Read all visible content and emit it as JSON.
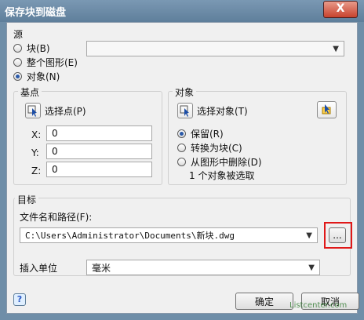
{
  "window": {
    "title": "保存块到磁盘",
    "close_label": "X"
  },
  "source": {
    "legend": "源",
    "block_label": "块(B)",
    "entire_drawing_label": "整个图形(E)",
    "objects_label": "对象(N)",
    "selected_index": 2,
    "block_select_value": ""
  },
  "basepoint": {
    "legend": "基点",
    "pick_label": "选择点(P)",
    "x_label": "X:",
    "y_label": "Y:",
    "z_label": "Z:",
    "x_value": "0",
    "y_value": "0",
    "z_value": "0"
  },
  "objects": {
    "legend": "对象",
    "select_label": "选择对象(T)",
    "retain_label": "保留(R)",
    "convert_label": "转换为块(C)",
    "delete_label": "从图形中删除(D)",
    "selected_count_text": "1 个对象被选取",
    "selected_option": 0
  },
  "target": {
    "legend": "目标",
    "file_label": "文件名和路径(F):",
    "file_value": "C:\\Users\\Administrator\\Documents\\新块.dwg",
    "browse_label": "..."
  },
  "units": {
    "label": "插入单位",
    "value": "毫米"
  },
  "buttons": {
    "ok_label": "确定",
    "cancel_label": "取消",
    "help_label": "?"
  },
  "watermark": "Listcenter.com"
}
